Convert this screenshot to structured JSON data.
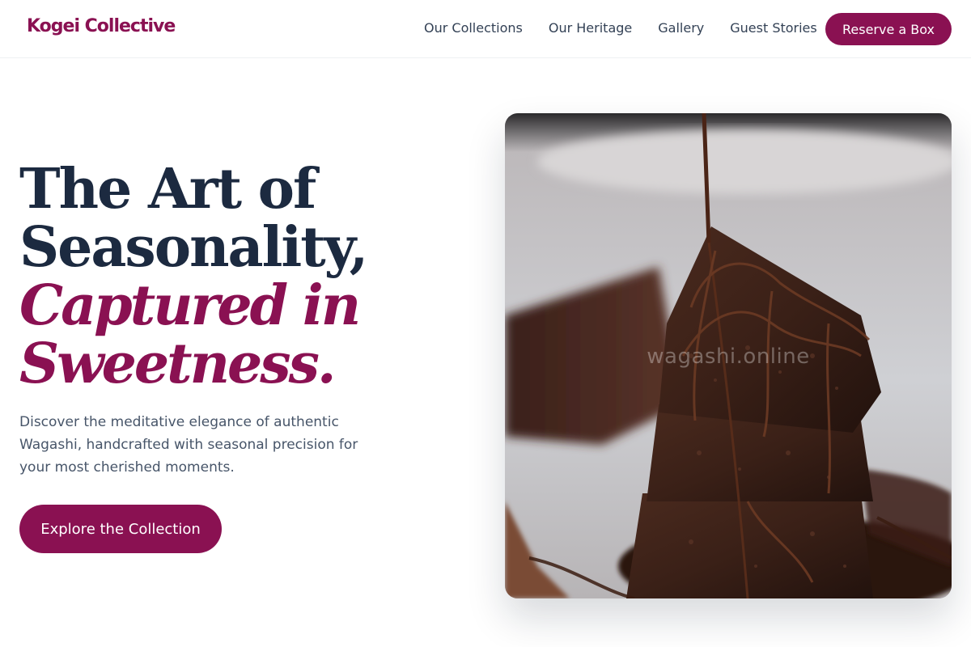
{
  "brand": {
    "name": "Kogei Collective",
    "accent_color": "#8a1152"
  },
  "nav": {
    "links": [
      "Our Collections",
      "Our Heritage",
      "Gallery",
      "Guest Stories"
    ],
    "cta_label": "Reserve a Box"
  },
  "hero": {
    "title_lines": [
      "The Art of",
      "Seasonality,"
    ],
    "title_accent_lines": [
      "Captured in",
      "Sweetness."
    ],
    "description": "Discover the meditative elegance of authentic Wagashi, handcrafted with seasonal precision for your most cherished moments.",
    "cta_label": "Explore the Collection",
    "image": {
      "subject": "stacked chocolate cake slices drizzled with chocolate sauce",
      "watermark": "wagashi.online"
    }
  }
}
